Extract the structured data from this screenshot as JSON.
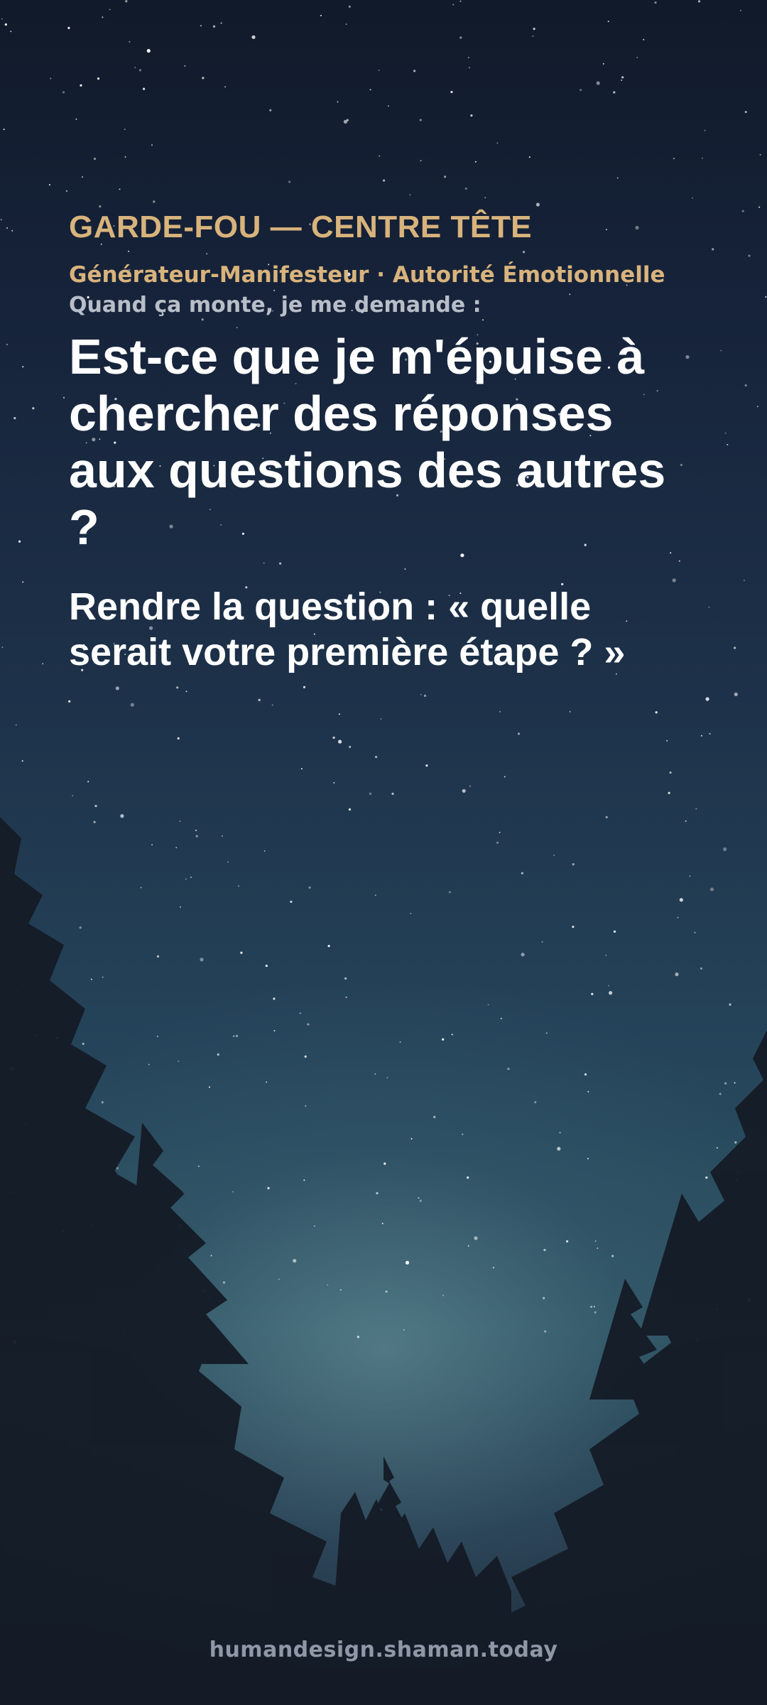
{
  "card": {
    "kicker": "GARDE-FOU — CENTRE TÊTE",
    "subtitle": "Générateur-Manifesteur · Autorité Émotionnelle",
    "prompt": "Quand ça monte, je me demande :",
    "question": "Est-ce que je m'épuise à chercher des réponses aux questions des autres ?",
    "answer": "Rendre la question : « quelle serait votre première étape ? »"
  },
  "footer": {
    "url": "humandesign.shaman.today"
  },
  "colors": {
    "accent": "#d8b37c",
    "text": "#ffffff",
    "muted": "#b8bec8",
    "footer": "#8f98a6"
  }
}
